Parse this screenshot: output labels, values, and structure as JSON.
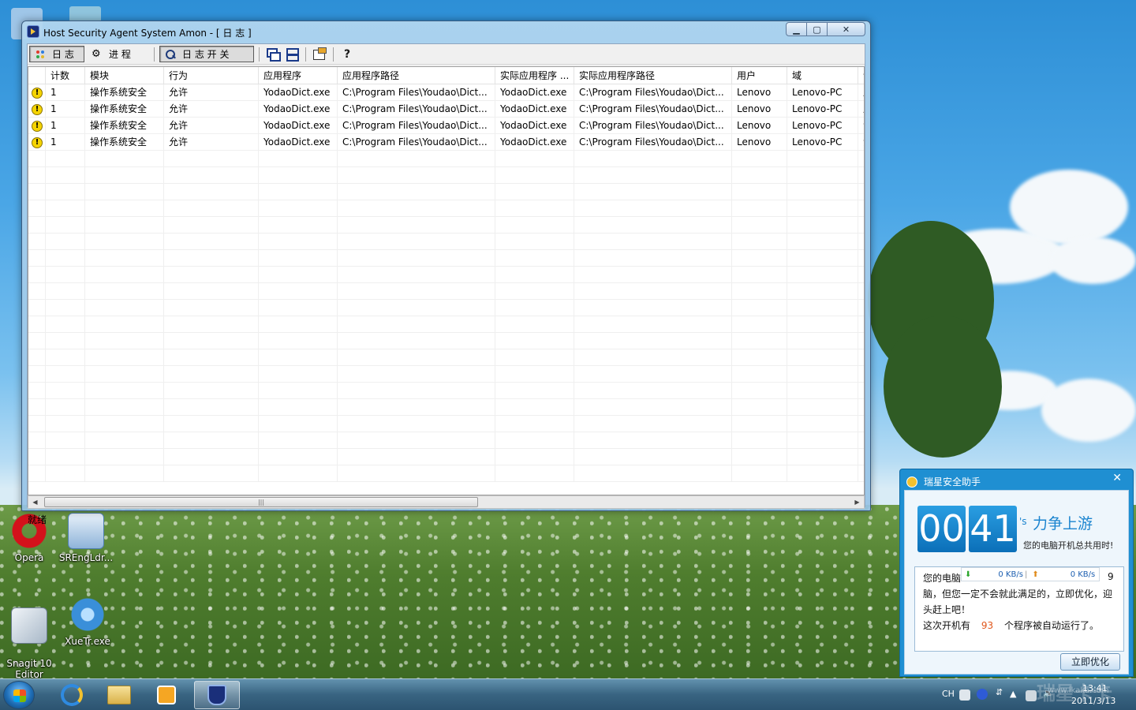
{
  "window": {
    "title": "Host Security Agent System Amon - [ 日 志 ]",
    "controls": {
      "minimize": "▁",
      "maximize": "▢",
      "close": "✕"
    }
  },
  "toolbar": {
    "log_label": "日 志",
    "process_label": "进 程",
    "log_switch_label": "日 志 开 关",
    "help_glyph": "?"
  },
  "table": {
    "columns": [
      "",
      "计数",
      "模块",
      "行为",
      "应用程序",
      "应用程序路径",
      "实际应用程序 ...",
      "实际应用程序路径",
      "用户",
      "域",
      "记"
    ],
    "rows": [
      {
        "icon": "!",
        "count": "1",
        "module": "操作系统安全",
        "action": "允许",
        "app": "YodaoDict.exe",
        "path": "C:\\Program Files\\Youdao\\Dict...",
        "real_app": "YodaoDict.exe",
        "real_path": "C:\\Program Files\\Youdao\\Dict...",
        "user": "Lenovo",
        "domain": "Lenovo-PC",
        "extra": "启"
      },
      {
        "icon": "!",
        "count": "1",
        "module": "操作系统安全",
        "action": "允许",
        "app": "YodaoDict.exe",
        "path": "C:\\Program Files\\Youdao\\Dict...",
        "real_app": "YodaoDict.exe",
        "real_path": "C:\\Program Files\\Youdao\\Dict...",
        "user": "Lenovo",
        "domain": "Lenovo-PC",
        "extra": "启"
      },
      {
        "icon": "!",
        "count": "1",
        "module": "操作系统安全",
        "action": "允许",
        "app": "YodaoDict.exe",
        "path": "C:\\Program Files\\Youdao\\Dict...",
        "real_app": "YodaoDict.exe",
        "real_path": "C:\\Program Files\\Youdao\\Dict...",
        "user": "Lenovo",
        "domain": "Lenovo-PC",
        "extra": "注"
      },
      {
        "icon": "!",
        "count": "1",
        "module": "操作系统安全",
        "action": "允许",
        "app": "YodaoDict.exe",
        "path": "C:\\Program Files\\Youdao\\Dict...",
        "real_app": "YodaoDict.exe",
        "real_path": "C:\\Program Files\\Youdao\\Dict...",
        "user": "Lenovo",
        "domain": "Lenovo-PC",
        "extra": "注"
      }
    ],
    "empty_row_count": 20
  },
  "scrollbar": {
    "left_arrow": "◀",
    "right_arrow": "▶",
    "grip": "|||"
  },
  "status": {
    "text": "就绪"
  },
  "desktop_icons": [
    {
      "label": "Opera",
      "icon": "opera-icon",
      "color": "#d4111b"
    },
    {
      "label": "SREngLdr...",
      "icon": "srengldr-icon",
      "color": "#5f95c9"
    },
    {
      "label": "Snagit 10\nEditor",
      "icon": "snagit-icon",
      "color": "#c9d5e2"
    },
    {
      "label": "XueTr.exe",
      "icon": "xuetr-icon",
      "color": "#3a8fd9"
    }
  ],
  "popup": {
    "title": "瑞星安全助手",
    "close": "✕",
    "hours": "00",
    "minutes": "41",
    "slogan_prefix": "'s",
    "slogan": "力争上游",
    "uptime_label": "您的电脑开机总共用时!",
    "speed_down": "0 KB/s",
    "speed_up": "0 KB/s",
    "msg_line1": "您的电脑",
    "msg_line1_tail": "9",
    "msg_line2": "脑，但您一定不会就此满足的，立即优化，迎",
    "msg_line3": "头赶上吧！",
    "msg_line4_a": "这次开机有",
    "msg_count": "93",
    "msg_line4_b": "个程序被自动运行了。",
    "optimize_button": "立即优化"
  },
  "taskbar": {
    "apps": [
      "ie-icon",
      "explorer-icon",
      "media-player-icon",
      "amon-icon"
    ],
    "tray": {
      "lang": "CH",
      "time": "13:41",
      "date": "2011/3/13",
      "watermark": "瑞星卡卡",
      "watermark_url": "www.ikaka.com"
    }
  },
  "colors": {
    "accent": "#1f8fd2",
    "warning": "#f5d400",
    "count_highlight": "#e0571c"
  }
}
